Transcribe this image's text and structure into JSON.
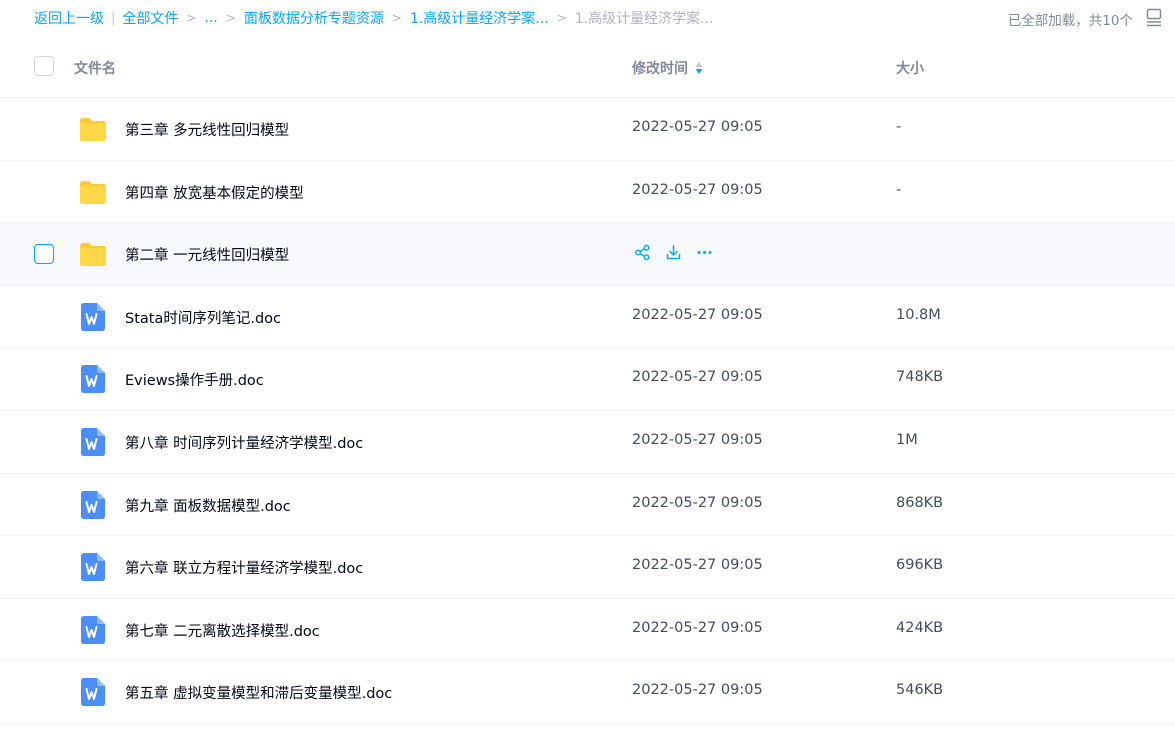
{
  "breadcrumb": {
    "back": "返回上一级",
    "separator_bar": "|",
    "root": "全部文件",
    "separator_arrow": ">",
    "ellipsis": "...",
    "level_1": "面板数据分析专题资源",
    "level_2": "1.高级计量经济学案...",
    "current": "1.高级计量经济学案..."
  },
  "status": {
    "load_text": "已全部加载，共10个"
  },
  "header": {
    "name": "文件名",
    "modified": "修改时间",
    "size": "大小"
  },
  "colors": {
    "accent": "#06a7ff",
    "folder": "#ffd84a",
    "doc": "#4b8ef7"
  },
  "rows": [
    {
      "type": "folder",
      "name": "第三章 多元线性回归模型",
      "time": "2022-05-27 09:05",
      "size": "-"
    },
    {
      "type": "folder",
      "name": "第四章 放宽基本假定的模型",
      "time": "2022-05-27 09:05",
      "size": "-"
    },
    {
      "type": "folder",
      "name": "第二章 一元线性回归模型",
      "time": "",
      "size": "",
      "hovered": true
    },
    {
      "type": "doc",
      "name": "Stata时间序列笔记.doc",
      "time": "2022-05-27 09:05",
      "size": "10.8M"
    },
    {
      "type": "doc",
      "name": "Eviews操作手册.doc",
      "time": "2022-05-27 09:05",
      "size": "748KB"
    },
    {
      "type": "doc",
      "name": "第八章 时间序列计量经济学模型.doc",
      "time": "2022-05-27 09:05",
      "size": "1M"
    },
    {
      "type": "doc",
      "name": "第九章 面板数据模型.doc",
      "time": "2022-05-27 09:05",
      "size": "868KB"
    },
    {
      "type": "doc",
      "name": "第六章 联立方程计量经济学模型.doc",
      "time": "2022-05-27 09:05",
      "size": "696KB"
    },
    {
      "type": "doc",
      "name": "第七章 二元离散选择模型.doc",
      "time": "2022-05-27 09:05",
      "size": "424KB"
    },
    {
      "type": "doc",
      "name": "第五章 虚拟变量模型和滞后变量模型.doc",
      "time": "2022-05-27 09:05",
      "size": "546KB"
    }
  ]
}
